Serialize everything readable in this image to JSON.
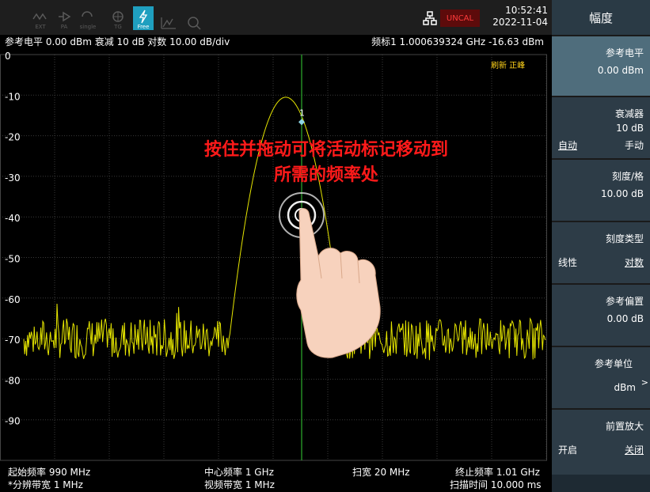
{
  "toolbar": {
    "icons": [
      "EXT",
      "PA",
      "single",
      "TG",
      "Free"
    ],
    "uncal": "UNCAL",
    "time": "10:52:41",
    "date": "2022-11-04",
    "accent": "#1f9fbf"
  },
  "info": {
    "left": "参考电平 0.00 dBm  衰减 10 dB  对数 10.00 dB/div",
    "marker": "频标1 1.000639324 GHz  -16.63 dBm"
  },
  "plot": {
    "refresh_label": "刷新 正峰",
    "y_labels": [
      "0",
      "-10",
      "-20",
      "-30",
      "-40",
      "-50",
      "-60",
      "-70",
      "-80",
      "-90"
    ],
    "marker_label": "1",
    "hint_line1": "按住并拖动可将活动标记移动到",
    "hint_line2": "所需的频率处",
    "trace_color": "#e6e600",
    "marker_color": "#2aa02a",
    "hint_color": "#ff1a1a"
  },
  "bottom": {
    "start": "起始频率 990 MHz",
    "center": "中心频率 1 GHz",
    "span": "扫宽 20 MHz",
    "stop": "终止频率 1.01 GHz",
    "rbw": "*分辨带宽 1 MHz",
    "vbw": "视频带宽 1 MHz",
    "sweep": "扫描时间 10.000 ms"
  },
  "sidebar": {
    "title": "幅度",
    "ref_level": {
      "label": "参考电平",
      "value": "0.00 dBm"
    },
    "attenuator": {
      "label": "衰减器",
      "value": "10 dB",
      "auto": "自动",
      "manual": "手动"
    },
    "scale_div": {
      "label": "刻度/格",
      "value": "10.00 dB"
    },
    "scale_type": {
      "label": "刻度类型",
      "linear": "线性",
      "log": "对数"
    },
    "ref_offset": {
      "label": "参考偏置",
      "value": "0.00 dB"
    },
    "ref_unit": {
      "label": "参考单位",
      "value": "dBm",
      "arrow": ">"
    },
    "preamp": {
      "label": "前置放大",
      "on": "开启",
      "off": "关闭"
    }
  }
}
